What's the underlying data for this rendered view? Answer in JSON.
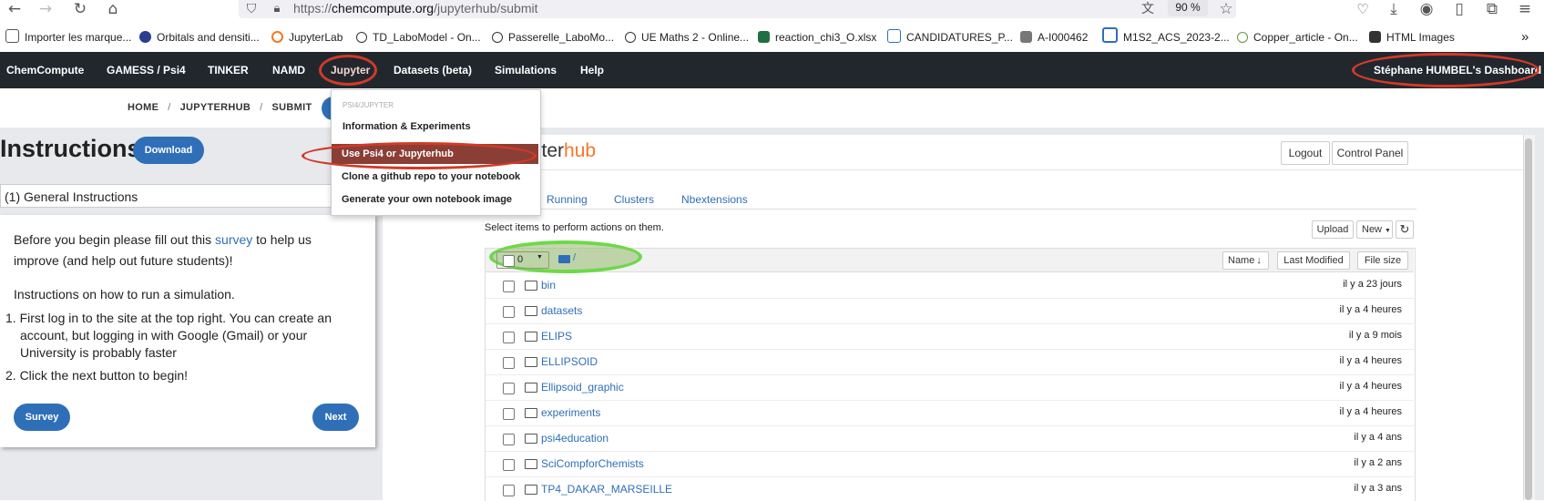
{
  "browser": {
    "url_prefix": "https://",
    "url_domain": "chemcompute.org",
    "url_path": "/jupyterhub/submit",
    "zoom": "90 %"
  },
  "bookmarks": [
    {
      "label": "Importer les marque...",
      "color": "#555555"
    },
    {
      "label": "Orbitals and densiti...",
      "color": "#2a3d8f"
    },
    {
      "label": "JupyterLab",
      "color": "#f37726"
    },
    {
      "label": "TD_LaboModel - On...",
      "color": "#333333"
    },
    {
      "label": "Passerelle_LaboMo...",
      "color": "#333333"
    },
    {
      "label": "UE Maths 2 - Online...",
      "color": "#333333"
    },
    {
      "label": "reaction_chi3_O.xlsx",
      "color": "#1f6f43"
    },
    {
      "label": "CANDIDATURES_P...",
      "color": "#2f6fb7"
    },
    {
      "label": "A-I000462",
      "color": "#777777"
    },
    {
      "label": "M1S2_ACS_2023-2...",
      "color": "#2f6fb7"
    },
    {
      "label": "Copper_article - On...",
      "color": "#5a9a3a"
    },
    {
      "label": "HTML Images",
      "color": "#333333"
    }
  ],
  "nav": {
    "items": [
      "ChemCompute",
      "GAMESS / Psi4",
      "TINKER",
      "NAMD",
      "Jupyter",
      "Datasets (beta)",
      "Simulations",
      "Help"
    ],
    "dashboard": "Stéphane HUMBEL's Dashboard"
  },
  "breadcrumb": [
    "HOME",
    "JUPYTERHUB",
    "SUBMIT"
  ],
  "instructions": {
    "title": "Instructions",
    "download": "Download",
    "section": "(1) General Instructions",
    "p1_before": "Before you begin please fill out this ",
    "p1_link": "survey",
    "p1_after": " to help us",
    "p1_line2": "improve (and help out future students)!",
    "p2": "Instructions on how to run a simulation.",
    "step1_line1": "1. First log in to the site at the top right. You can create an",
    "step1_line2": "account, but logging in with Google (Gmail) or your",
    "step1_line3": "University is probably faster",
    "step2": "2. Click the next button to begin!",
    "survey_btn": "Survey",
    "next_btn": "Next"
  },
  "dropdown": {
    "header": "PSI4/JUPYTER",
    "items": [
      "Information & Experiments",
      "Use Psi4 or Jupyterhub",
      "Clone a github repo to your notebook",
      "Generate your own notebook image"
    ]
  },
  "jupyter": {
    "logo_main": "yter",
    "logo_accent": "hub",
    "logout": "Logout",
    "control_panel": "Control Panel",
    "tabs": [
      "Running",
      "Clusters",
      "Nbextensions"
    ],
    "select_hint": "Select items to perform actions on them.",
    "upload": "Upload",
    "new": "New",
    "selected_count": "0",
    "path": "/",
    "col_name": "Name",
    "col_modified": "Last Modified",
    "col_size": "File size",
    "files": [
      {
        "name": "bin",
        "modified": "il y a 23 jours"
      },
      {
        "name": "datasets",
        "modified": "il y a 4 heures"
      },
      {
        "name": "ELIPS",
        "modified": "il y a 9 mois"
      },
      {
        "name": "ELLIPSOID",
        "modified": "il y a 4 heures"
      },
      {
        "name": "Ellipsoid_graphic",
        "modified": "il y a 4 heures"
      },
      {
        "name": "experiments",
        "modified": "il y a 4 heures"
      },
      {
        "name": "psi4education",
        "modified": "il y a 4 ans"
      },
      {
        "name": "SciCompforChemists",
        "modified": "il y a 2 ans"
      },
      {
        "name": "TP4_DAKAR_MARSEILLE",
        "modified": "il y a 3 ans"
      }
    ]
  },
  "colors": {
    "accent": "#2f6fb7",
    "nav_bg": "#22272e",
    "annotation_red": "#d23a27",
    "annotation_green": "#6ed84a"
  }
}
